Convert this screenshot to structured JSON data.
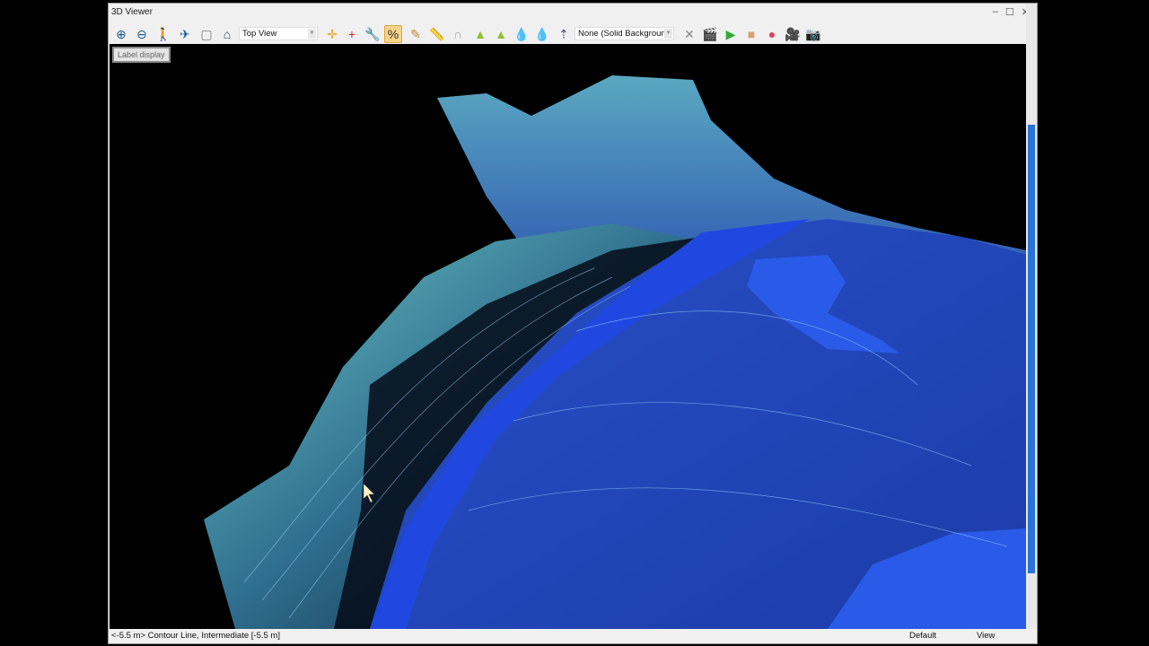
{
  "window": {
    "title": "3D Viewer",
    "controls": [
      "–",
      "☐",
      "✕"
    ]
  },
  "toolbar": {
    "view_select": "Top View",
    "background_select": "None (Solid Background",
    "icons": [
      {
        "name": "zoom-in-icon",
        "glyph": "⊕",
        "color": "#1e5b8a"
      },
      {
        "name": "zoom-out-icon",
        "glyph": "⊖",
        "color": "#1e5b8a"
      },
      {
        "name": "walk-icon",
        "glyph": "🚶",
        "color": "#1e5b8a"
      },
      {
        "name": "helicopter-icon",
        "glyph": "✈",
        "color": "#1e5b8a"
      },
      {
        "name": "cube-icon",
        "glyph": "▢",
        "color": "#777"
      },
      {
        "name": "home-icon",
        "glyph": "⌂",
        "color": "#1e4b6a"
      }
    ],
    "icons2": [
      {
        "name": "crosshair-icon",
        "glyph": "✛",
        "color": "#f0a020"
      },
      {
        "name": "axis-cross-icon",
        "glyph": "+",
        "color": "#c03030"
      },
      {
        "name": "wrench-icon",
        "glyph": "🔧",
        "color": "#334"
      },
      {
        "name": "slope-icon",
        "glyph": "%",
        "color": "#333",
        "active": true
      },
      {
        "name": "pencil-icon",
        "glyph": "✎",
        "color": "#d08020"
      },
      {
        "name": "ruler-icon",
        "glyph": "📏",
        "color": "#d0a030"
      },
      {
        "name": "magnet-icon",
        "glyph": "∩",
        "color": "#aaa"
      },
      {
        "name": "terrain-lower-icon",
        "glyph": "▲",
        "color": "#8fbf30"
      },
      {
        "name": "terrain-raise-icon",
        "glyph": "▲",
        "color": "#8fbf30"
      },
      {
        "name": "water-level-down-icon",
        "glyph": "💧",
        "color": "#557"
      },
      {
        "name": "water-level-up-icon",
        "glyph": "💧",
        "color": "#557"
      },
      {
        "name": "tree-icon",
        "glyph": "⇡",
        "color": "#557"
      }
    ],
    "icons3": [
      {
        "name": "clear-icon",
        "glyph": "✕",
        "color": "#888"
      },
      {
        "name": "clapper-icon",
        "glyph": "🎬",
        "color": "#333"
      },
      {
        "name": "play-icon",
        "glyph": "▶",
        "color": "#3a3"
      },
      {
        "name": "stop-icon",
        "glyph": "■",
        "color": "#d9a070"
      },
      {
        "name": "record-icon",
        "glyph": "●",
        "color": "#e04060"
      },
      {
        "name": "video-camera-icon",
        "glyph": "🎥",
        "color": "#1e3a5a"
      },
      {
        "name": "camera-icon",
        "glyph": "📷",
        "color": "#1e3a5a"
      }
    ]
  },
  "viewport": {
    "label_display": "Label display"
  },
  "status": {
    "left": "<-5.5 m> Contour Line, Intermediate [-5.5 m]",
    "mode": "Default",
    "view": "View"
  }
}
